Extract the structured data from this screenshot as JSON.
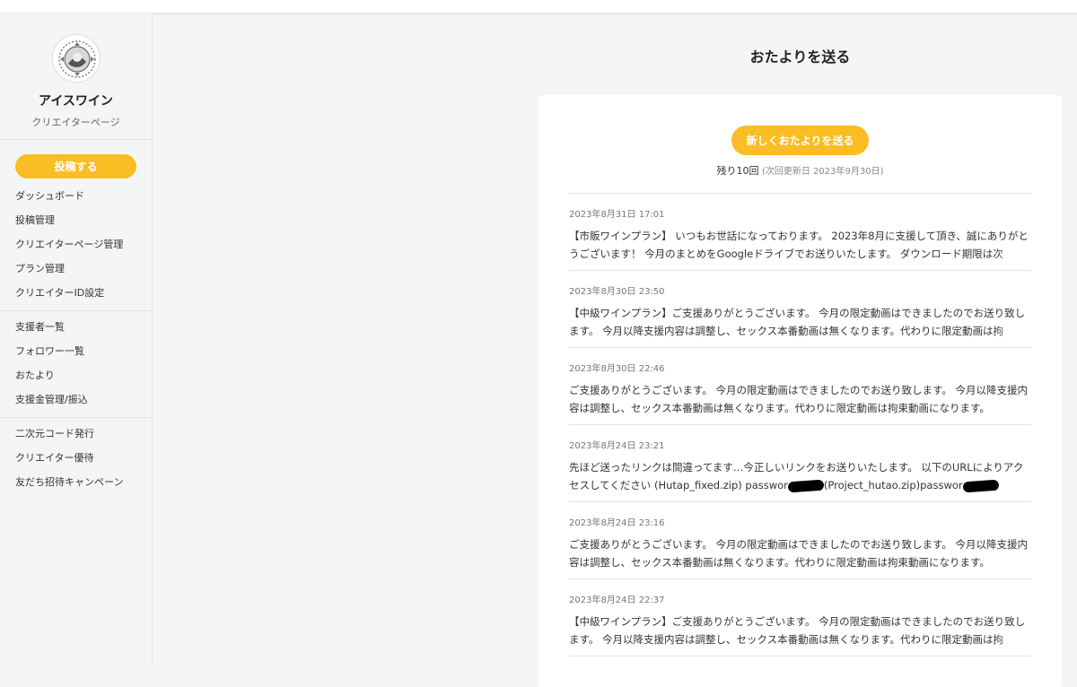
{
  "sidebar": {
    "creator_name": "アイスワイン",
    "creator_subtitle": "クリエイターページ",
    "post_button": "投稿する",
    "group1": [
      "ダッシュボード",
      "投稿管理",
      "クリエイターページ管理",
      "プラン管理",
      "クリエイターID設定"
    ],
    "group2": [
      "支援者一覧",
      "フォロワー一覧",
      "おたより",
      "支援金管理/振込"
    ],
    "group3": [
      "二次元コード発行",
      "クリエイター優待",
      "友だち招待キャンペーン"
    ]
  },
  "main": {
    "title": "おたよりを送る",
    "new_button": "新しくおたよりを送る",
    "remaining": "残り10回",
    "next_update": "(次回更新日 2023年9月30日)"
  },
  "messages": [
    {
      "date": "2023年8月31日 17:01",
      "body": "【市販ワインプラン】 いつもお世話になっております。 2023年8月に支援して頂き、誠にありがとうございます！ 今月のまとめをGoogleドライブでお送りいたします。 ダウンロード期限は次"
    },
    {
      "date": "2023年8月30日 23:50",
      "body": "【中級ワインプラン】ご支援ありがとうございます。 今月の限定動画はできましたのでお送り致します。 今月以降支援内容は調整し、セックス本番動画は無くなります。代わりに限定動画は拘"
    },
    {
      "date": "2023年8月30日 22:46",
      "body": "ご支援ありがとうございます。 今月の限定動画はできましたのでお送り致します。 今月以降支援内容は調整し、セックス本番動画は無くなります。代わりに限定動画は拘束動画になります。"
    },
    {
      "date": "2023年8月24日 23:21",
      "body_a": "先ほど送ったリンクは間違ってます…今正しいリンクをお送りいたします。 以下のURLによりアクセスしてください (Hutap_fixed.zip) passwor",
      "body_b": "(Project_hutao.zip)passwor"
    },
    {
      "date": "2023年8月24日 23:16",
      "body": "ご支援ありがとうございます。 今月の限定動画はできましたのでお送り致します。 今月以降支援内容は調整し、セックス本番動画は無くなります。代わりに限定動画は拘束動画になります。"
    },
    {
      "date": "2023年8月24日 22:37",
      "body": "【中級ワインプラン】ご支援ありがとうございます。 今月の限定動画はできましたのでお送り致します。 今月以降支援内容は調整し、セックス本番動画は無くなります。代わりに限定動画は拘"
    }
  ]
}
